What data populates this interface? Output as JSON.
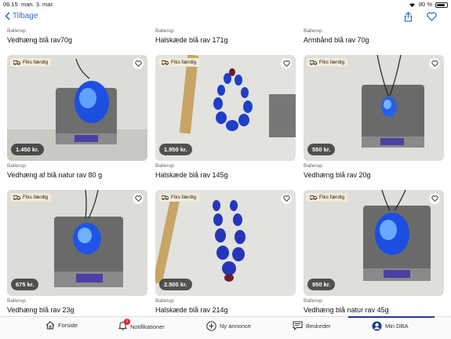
{
  "status": {
    "time": "06.15",
    "date": "man. 3. mar.",
    "battery": "80 %",
    "battery_level": 0.8
  },
  "nav": {
    "back_label": "Tilbage"
  },
  "top_labels": [
    {
      "location": "Ballerup",
      "title": "Vedhæng blå rav70g"
    },
    {
      "location": "Ballerup",
      "title": "Halskæde blå rav 171g"
    },
    {
      "location": "Ballerup",
      "title": "Armbånd blå rav 70g"
    }
  ],
  "listings": [
    {
      "badge": "Fiks færdig",
      "price": "1.450 kr.",
      "location": "Ballerup",
      "title": "Vedhæng af blå natur rav 80 g"
    },
    {
      "badge": "Fiks færdig",
      "price": "1.950 kr.",
      "location": "Ballerup",
      "title": "Halskæde blå rav 145g"
    },
    {
      "badge": "Fiks færdig",
      "price": "550 kr.",
      "location": "Ballerup",
      "title": "Vedhæng blå rav 20g"
    },
    {
      "badge": "Fiks færdig",
      "price": "675 kr.",
      "location": "Ballerup",
      "title": "Vedhæng blå rav 23g"
    },
    {
      "badge": "Fiks færdig",
      "price": "2.500 kr.",
      "location": "Ballerup",
      "title": "Halskæde blå rav 214g"
    },
    {
      "badge": "Fiks færdig",
      "price": "950 kr.",
      "location": "Ballerup",
      "title": "Vedhæng blå natur rav 45g"
    }
  ],
  "tabs": [
    {
      "label": "Forside",
      "icon": "home-icon"
    },
    {
      "label": "Notifikationer",
      "icon": "bell-icon",
      "badge": "1"
    },
    {
      "label": "Ny annonce",
      "icon": "plus-circle-icon"
    },
    {
      "label": "Beskeder",
      "icon": "chat-icon"
    },
    {
      "label": "Min DBA",
      "icon": "profile-icon",
      "active": true
    }
  ],
  "colors": {
    "accent": "#2f6fd6",
    "active_tab": "#1a3a8c",
    "badge_bg": "#f3ead6",
    "notif_red": "#e0202a"
  }
}
